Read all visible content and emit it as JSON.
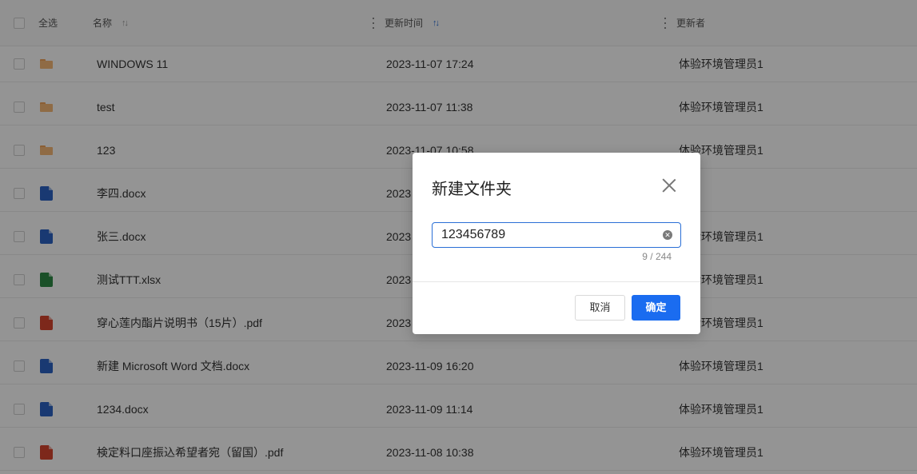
{
  "table": {
    "header": {
      "select_all": "全选",
      "name": "名称",
      "updated_time": "更新时间",
      "updater": "更新者",
      "sort_glyph": "↑↓"
    },
    "rows": [
      {
        "type": "folder",
        "icon": "folder-icon",
        "name": "WINDOWS 11",
        "time": "2023-11-07 17:24",
        "updater": "体验环境管理员1"
      },
      {
        "type": "folder",
        "icon": "folder-icon",
        "name": "test",
        "time": "2023-11-07 11:38",
        "updater": "体验环境管理员1"
      },
      {
        "type": "folder",
        "icon": "folder-icon",
        "name": "123",
        "time": "2023-11-07 10:58",
        "updater": "体验环境管理员1"
      },
      {
        "type": "word",
        "icon": "word-file-icon",
        "name": "李四.docx",
        "time": "2023",
        "updater": ""
      },
      {
        "type": "word",
        "icon": "word-file-icon",
        "name": "张三.docx",
        "time": "2023",
        "updater": "体验环境管理员1"
      },
      {
        "type": "excel",
        "icon": "excel-file-icon",
        "name": "测试TTT.xlsx",
        "time": "2023",
        "updater": "体验环境管理员1"
      },
      {
        "type": "pdf",
        "icon": "pdf-file-icon",
        "name": "穿心莲内酯片说明书（15片）.pdf",
        "time": "2023",
        "updater": "体验环境管理员1"
      },
      {
        "type": "word",
        "icon": "word-file-icon",
        "name": "新建 Microsoft Word 文档.docx",
        "time": "2023-11-09 16:20",
        "updater": "体验环境管理员1"
      },
      {
        "type": "word",
        "icon": "word-file-icon",
        "name": "1234.docx",
        "time": "2023-11-09 11:14",
        "updater": "体验环境管理员1"
      },
      {
        "type": "pdf",
        "icon": "pdf-file-icon",
        "name": "検定料口座振込希望者宛（留国）.pdf",
        "time": "2023-11-08 10:38",
        "updater": "体验环境管理员1"
      }
    ]
  },
  "modal": {
    "title": "新建文件夹",
    "input_value": "123456789",
    "char_count": "9 / 244",
    "cancel_label": "取消",
    "ok_label": "确定"
  },
  "colors": {
    "primary": "#1a6cf0",
    "overlay": "rgba(0,0,0,0.42)"
  }
}
